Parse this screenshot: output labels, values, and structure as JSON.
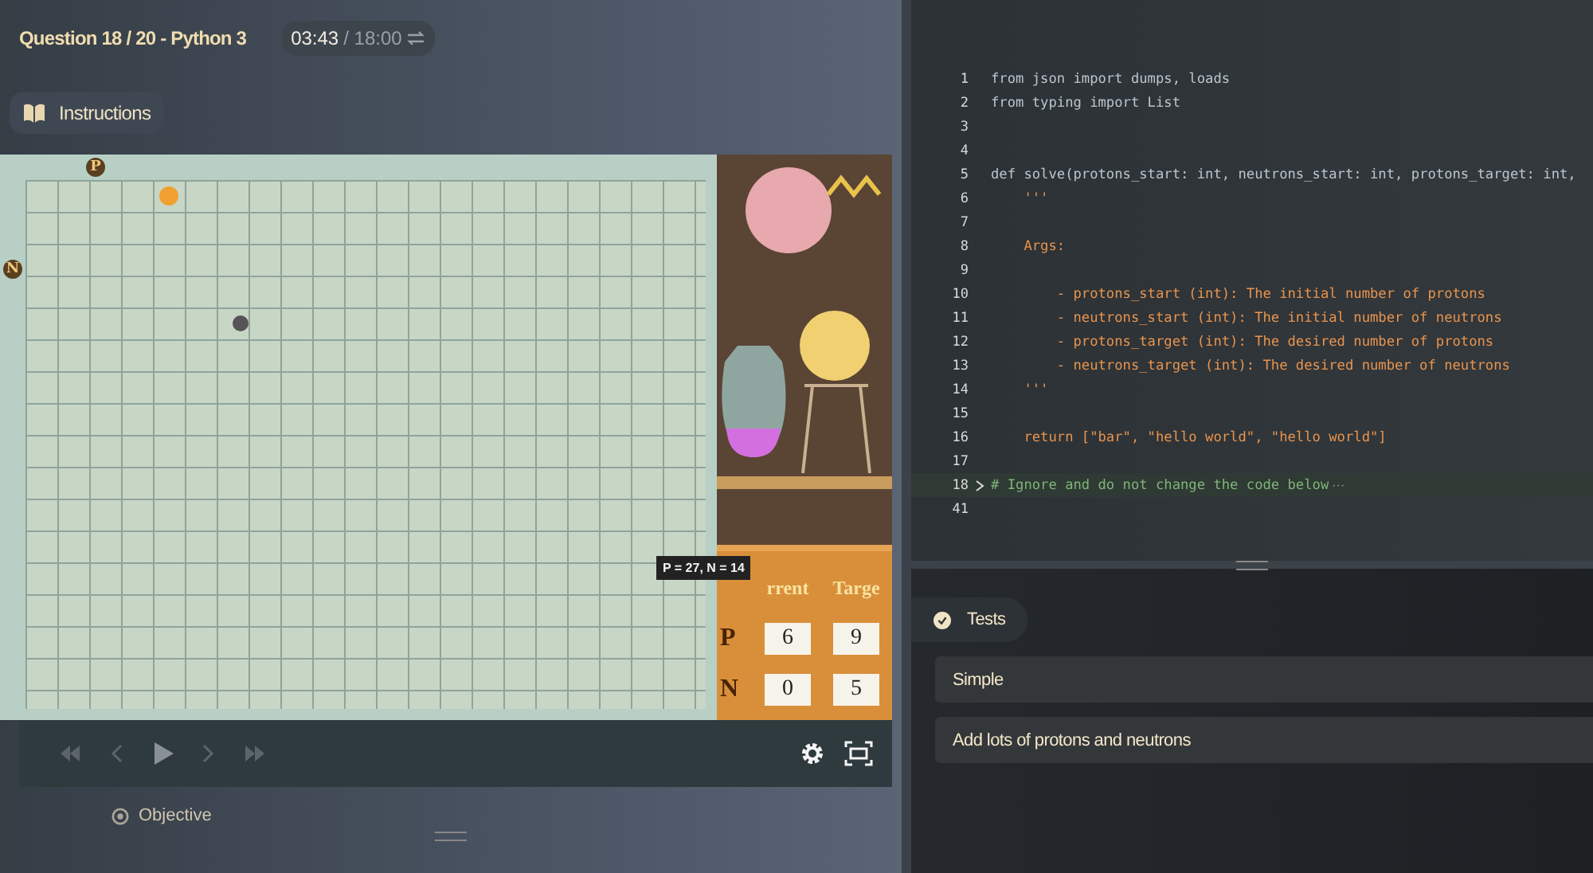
{
  "header": {
    "title": "Question 18 / 20 - Python 3",
    "timer": {
      "elapsed": "03:43",
      "total": "/ 18:00"
    }
  },
  "instructions_tab": {
    "label": "Instructions"
  },
  "game": {
    "axis_labels": [
      "P",
      "N"
    ],
    "tooltip": "P = 27, N = 14",
    "table": {
      "columns": [
        "rrent",
        "Targe"
      ],
      "rows": [
        {
          "label": "P",
          "current": "6",
          "target": "9"
        },
        {
          "label": "N",
          "current": "0",
          "target": "5"
        }
      ]
    }
  },
  "objective_tab": {
    "label": "Objective"
  },
  "editor": {
    "lines": [
      {
        "number": "1",
        "text": "from json import dumps, loads",
        "kind": "code",
        "folded": false
      },
      {
        "number": "2",
        "text": "from typing import List",
        "kind": "code",
        "folded": false
      },
      {
        "number": "3",
        "folded": false
      },
      {
        "number": "4",
        "folded": false
      },
      {
        "number": "5",
        "text": "def solve(protons_start: int, neutrons_start: int, protons_target: int,",
        "kind": "code",
        "folded": false
      },
      {
        "number": "6",
        "text": "    '''",
        "kind": "doc",
        "folded": false
      },
      {
        "number": "7",
        "folded": false
      },
      {
        "number": "8",
        "text": "    Args:",
        "kind": "doc",
        "folded": false
      },
      {
        "number": "9",
        "folded": false
      },
      {
        "number": "10",
        "text": "        - protons_start (int): The initial number of protons",
        "kind": "doc",
        "folded": false
      },
      {
        "number": "11",
        "text": "        - neutrons_start (int): The initial number of neutrons",
        "kind": "doc",
        "folded": false
      },
      {
        "number": "12",
        "text": "        - protons_target (int): The desired number of protons",
        "kind": "doc",
        "folded": false
      },
      {
        "number": "13",
        "text": "        - neutrons_target (int): The desired number of neutrons",
        "kind": "doc",
        "folded": false
      },
      {
        "number": "14",
        "text": "    '''",
        "kind": "doc",
        "folded": false
      },
      {
        "number": "15",
        "folded": false
      },
      {
        "number": "16",
        "text": "    return [\"bar\", \"hello world\", \"hello world\"]",
        "kind": "doc",
        "folded": false
      },
      {
        "number": "17",
        "folded": false
      },
      {
        "number": "18",
        "text": "# Ignore and do not change the code below",
        "kind": "comment",
        "folded": true,
        "fold_marker": "···"
      },
      {
        "number": "41",
        "folded": false
      }
    ]
  },
  "tests": {
    "label": "Tests",
    "items": [
      {
        "name": "Simple"
      },
      {
        "name": "Add lots of protons and neutrons"
      }
    ]
  }
}
